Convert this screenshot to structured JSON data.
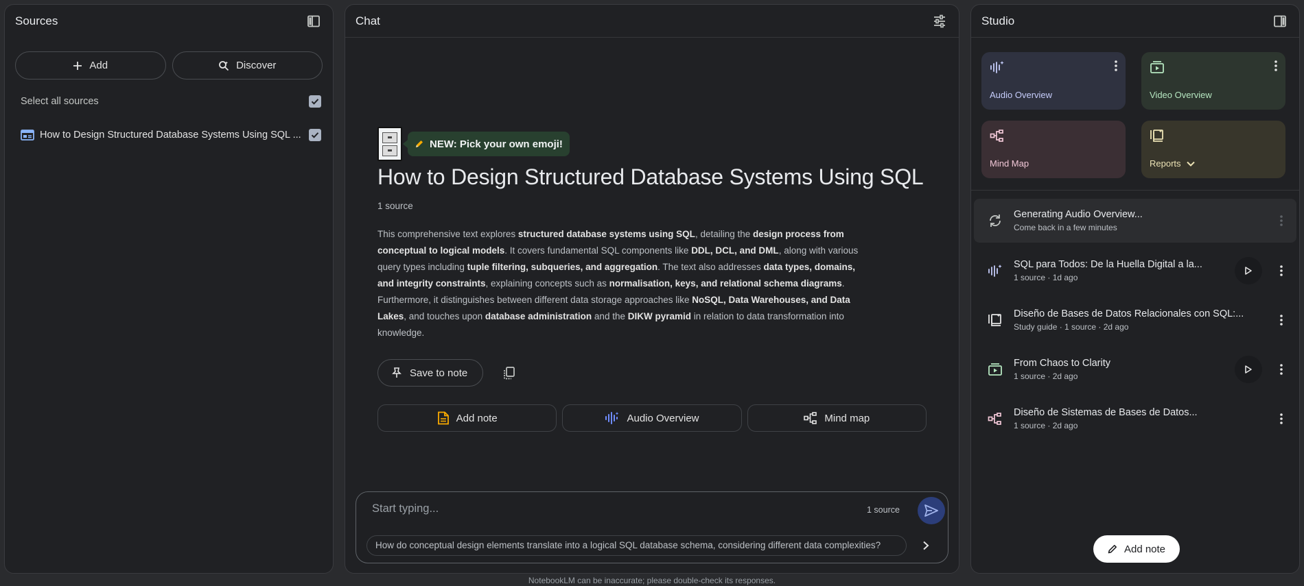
{
  "sources": {
    "title": "Sources",
    "add_label": "Add",
    "discover_label": "Discover",
    "select_all_label": "Select all sources",
    "items": [
      {
        "label": "How to Design Structured Database Systems Using SQL ..."
      }
    ]
  },
  "chat": {
    "title": "Chat",
    "tip": "NEW: Pick your own emoji!",
    "notebook_title": "How to Design Structured Database Systems Using SQL",
    "source_count": "1 source",
    "summary": [
      {
        "t": "This comprehensive text explores "
      },
      {
        "t": "structured database systems using SQL",
        "b": true
      },
      {
        "t": ", detailing the "
      },
      {
        "t": "design process from conceptual to logical models",
        "b": true
      },
      {
        "t": ". It covers fundamental SQL components like "
      },
      {
        "t": "DDL, DCL, and DML",
        "b": true
      },
      {
        "t": ", along with various query types including "
      },
      {
        "t": "tuple filtering, subqueries, and aggregation",
        "b": true
      },
      {
        "t": ". The text also addresses "
      },
      {
        "t": "data types, domains, and integrity constraints",
        "b": true
      },
      {
        "t": ", explaining concepts such as "
      },
      {
        "t": "normalisation, keys, and relational schema diagrams",
        "b": true
      },
      {
        "t": ". Furthermore, it distinguishes between different data storage approaches like "
      },
      {
        "t": "NoSQL, Data Warehouses, and Data Lakes",
        "b": true
      },
      {
        "t": ", and touches upon "
      },
      {
        "t": "database administration",
        "b": true
      },
      {
        "t": " and the "
      },
      {
        "t": "DIKW pyramid",
        "b": true
      },
      {
        "t": " in relation to data transformation into knowledge."
      }
    ],
    "save_to_note_label": "Save to note",
    "quick_actions": {
      "add_note": "Add note",
      "audio_overview": "Audio Overview",
      "mind_map": "Mind map"
    },
    "composer": {
      "placeholder": "Start typing...",
      "source_count": "1 source",
      "suggestion": "How do conceptual design elements translate into a logical SQL database schema, considering different data complexities?"
    },
    "disclaimer": "NotebookLM can be inaccurate; please double-check its responses."
  },
  "studio": {
    "title": "Studio",
    "tiles": {
      "audio": "Audio Overview",
      "video": "Video Overview",
      "mind_map": "Mind Map",
      "reports": "Reports"
    },
    "items": [
      {
        "title": "Generating Audio Overview...",
        "meta": "Come back in a few minutes",
        "icon": "sync-icon"
      },
      {
        "title": "SQL para Todos: De la Huella Digital a la...",
        "meta": "1 source · 1d ago",
        "icon": "audio-spark-icon"
      },
      {
        "title": "Diseño de Bases de Datos Relacionales con SQL:...",
        "meta": "Study guide · 1 source · 2d ago",
        "icon": "report-icon"
      },
      {
        "title": "From Chaos to Clarity",
        "meta": "1 source · 2d ago",
        "icon": "video-icon"
      },
      {
        "title": "Diseño de Sistemas de Bases de Datos...",
        "meta": "1 source · 2d ago",
        "icon": "mind-map-icon"
      }
    ],
    "add_note_label": "Add note"
  }
}
